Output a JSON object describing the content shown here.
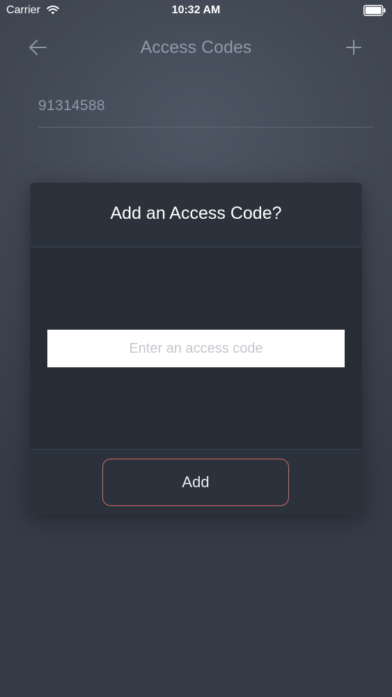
{
  "status_bar": {
    "carrier": "Carrier",
    "time": "10:32 AM",
    "wifi_icon": "wifi-icon",
    "battery_icon": "battery-icon"
  },
  "nav": {
    "title": "Access Codes",
    "back_icon": "arrow-left-icon",
    "add_icon": "plus-icon"
  },
  "codes": {
    "items": [
      "91314588"
    ]
  },
  "modal": {
    "title": "Add an Access Code?",
    "input": {
      "placeholder": "Enter an access code",
      "value": ""
    },
    "add_label": "Add"
  },
  "colors": {
    "background": "#3f4652",
    "modal_background": "#272d35",
    "button_border": "#d96a6a",
    "muted_text": "#8e98a7"
  }
}
